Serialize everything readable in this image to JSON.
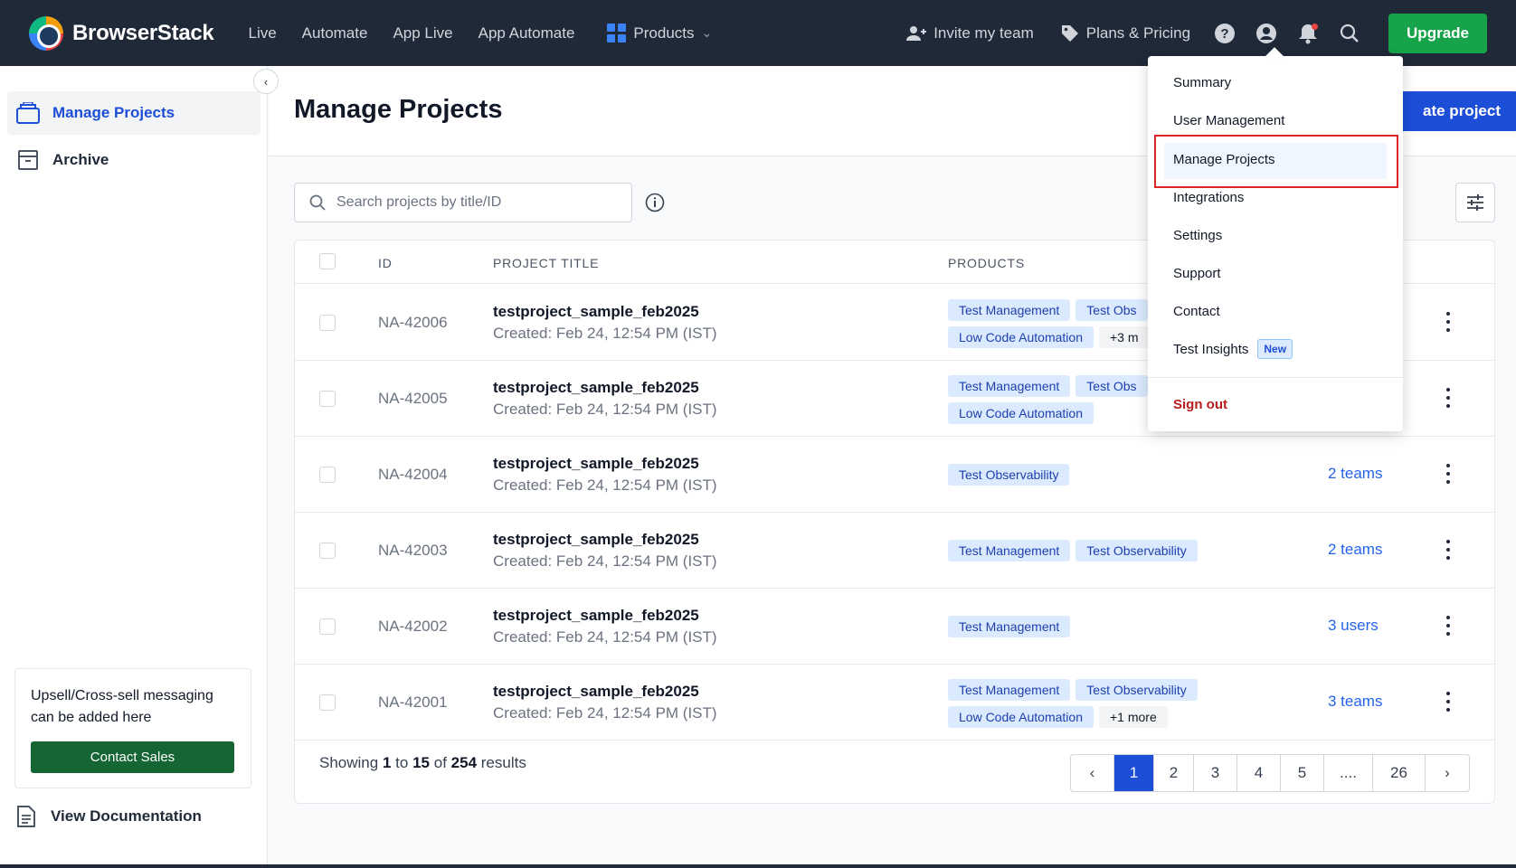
{
  "nav": {
    "brand": "BrowserStack",
    "links": [
      "Live",
      "Automate",
      "App Live",
      "App Automate"
    ],
    "products_label": "Products",
    "invite_label": "Invite my team",
    "plans_label": "Plans & Pricing",
    "upgrade_label": "Upgrade"
  },
  "sidebar": {
    "items": [
      {
        "label": "Manage Projects",
        "active": true
      },
      {
        "label": "Archive",
        "active": false
      }
    ],
    "upsell_text": "Upsell/Cross-sell messaging can be added here",
    "contact_label": "Contact Sales",
    "doc_label": "View Documentation"
  },
  "header": {
    "title": "Manage Projects",
    "create_label": "ate project"
  },
  "search": {
    "placeholder": "Search projects by title/ID"
  },
  "table": {
    "columns": [
      "ID",
      "PROJECT TITLE",
      "PRODUCTS"
    ],
    "rows": [
      {
        "id": "NA-42006",
        "title": "testproject_sample_feb2025",
        "created": "Created: Feb 24, 12:54 PM (IST)",
        "tags": [
          "Test Management",
          "Test Obs",
          "Low Code Automation",
          "+3 m"
        ],
        "access": ""
      },
      {
        "id": "NA-42005",
        "title": "testproject_sample_feb2025",
        "created": "Created: Feb 24, 12:54 PM (IST)",
        "tags": [
          "Test Management",
          "Test Obs",
          "Low Code Automation"
        ],
        "access": ""
      },
      {
        "id": "NA-42004",
        "title": "testproject_sample_feb2025",
        "created": "Created: Feb 24, 12:54 PM (IST)",
        "tags": [
          "Test Observability"
        ],
        "access": "2 teams"
      },
      {
        "id": "NA-42003",
        "title": "testproject_sample_feb2025",
        "created": "Created: Feb 24, 12:54 PM (IST)",
        "tags": [
          "Test Management",
          "Test Observability"
        ],
        "access": "2 teams"
      },
      {
        "id": "NA-42002",
        "title": "testproject_sample_feb2025",
        "created": "Created: Feb 24, 12:54 PM (IST)",
        "tags": [
          "Test Management"
        ],
        "access": "3 users"
      },
      {
        "id": "NA-42001",
        "title": "testproject_sample_feb2025",
        "created": "Created: Feb 24, 12:54 PM (IST)",
        "tags": [
          "Test Management",
          "Test Observability",
          "Low Code Automation",
          "+1 more"
        ],
        "access": "3 teams"
      }
    ]
  },
  "footer": {
    "showing_prefix": "Showing",
    "from": "1",
    "to_word": "to",
    "to": "15",
    "of_word": "of",
    "total": "254",
    "results_word": "results",
    "pages": [
      "‹",
      "1",
      "2",
      "3",
      "4",
      "5",
      "....",
      "26",
      "›"
    ],
    "current_page": "1"
  },
  "dropdown": {
    "items": [
      "Summary",
      "User Management",
      "Manage Projects",
      "Integrations",
      "Settings",
      "Support",
      "Contact",
      "Test Insights"
    ],
    "new_badge": "New",
    "signout": "Sign out"
  },
  "colors": {
    "nav_bg": "#1f2937",
    "primary": "#1d4ed8",
    "upgrade": "#16a34a",
    "highlight_box": "#dc2626"
  }
}
